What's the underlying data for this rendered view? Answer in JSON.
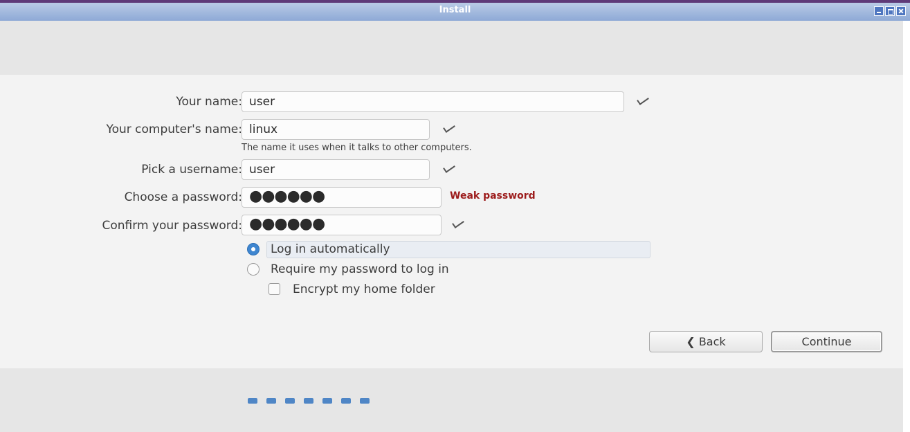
{
  "window": {
    "title": "Install"
  },
  "form": {
    "name_label": "Your name:",
    "name_value": "user",
    "computer_label": "Your computer's name:",
    "computer_value": "linux",
    "computer_hint": "The name it uses when it talks to other computers.",
    "username_label": "Pick a username:",
    "username_value": "user",
    "password_label": "Choose a password:",
    "password_value": "●●●●●●",
    "password_strength": "Weak password",
    "confirm_label": "Confirm your password:",
    "confirm_value": "●●●●●●"
  },
  "login_options": {
    "auto_label": "Log in automatically",
    "auto_selected": true,
    "require_label": "Require my password to log in",
    "require_selected": false,
    "encrypt_label": "Encrypt my home folder",
    "encrypt_checked": false
  },
  "buttons": {
    "back_label": "❮ Back",
    "continue_label": "Continue"
  },
  "progress": {
    "steps_total": 7
  },
  "colors": {
    "accent": "#3f86d0",
    "weak_password": "#9c1b1b",
    "titlebar": "#8ea9d6"
  }
}
